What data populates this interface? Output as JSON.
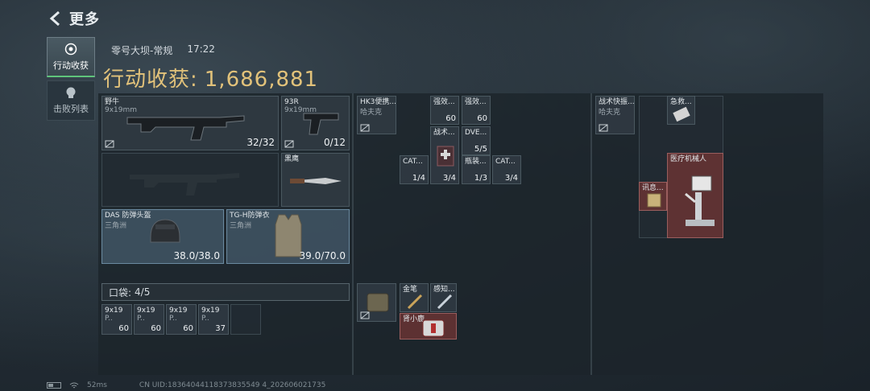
{
  "header": {
    "title": "更多"
  },
  "tabs": [
    {
      "label": "行动收获"
    },
    {
      "label": "击败列表"
    }
  ],
  "map_info": {
    "map": "零号大坝-常规",
    "time": "17:22"
  },
  "haul": {
    "label": "行动收获:",
    "value": "1,686,881"
  },
  "equipment": {
    "primary": {
      "name": "野牛",
      "caliber": "9x19mm",
      "ammo": "32/32"
    },
    "sidearm": {
      "name": "93R",
      "caliber": "9x19mm",
      "ammo": "0/12"
    },
    "melee": {
      "name": "黑鹰"
    },
    "helmet": {
      "name": "DAS 防弹头盔",
      "origin": "三角洲",
      "durability": "38.0/38.0"
    },
    "armor": {
      "name": "TG-H防弹衣",
      "origin": "三角洲",
      "durability": "39.0/70.0"
    }
  },
  "pouch": {
    "label": "口袋:",
    "count": "4/5",
    "items": [
      {
        "name": "9x19",
        "sub": "P..",
        "qty": "60"
      },
      {
        "name": "9x19",
        "sub": "P..",
        "qty": "60"
      },
      {
        "name": "9x19",
        "sub": "P..",
        "qty": "60"
      },
      {
        "name": "9x19",
        "sub": "P..",
        "qty": "37"
      }
    ]
  },
  "chest_rig": {
    "name": "HK3便携...",
    "sub": "哈夫克",
    "items": [
      {
        "name": "强效...",
        "qty": "60"
      },
      {
        "name": "强效...",
        "qty": "60"
      },
      {
        "name": "战术...",
        "qty": "3/4"
      },
      {
        "name": "DVE...",
        "qty": "5/5"
      },
      {
        "name": "CAT...",
        "qty": "1/4"
      },
      {
        "name": "瓶装...",
        "qty": "1/3"
      },
      {
        "name": "CAT...",
        "qty": "3/4"
      }
    ]
  },
  "backpack_small": {
    "items": [
      {
        "name": "金笔"
      },
      {
        "name": "感知..."
      },
      {
        "name": "肾小鹿..."
      }
    ]
  },
  "backpack": {
    "name": "战术快振...",
    "sub": "哈夫克",
    "items": [
      {
        "name": "急救..."
      },
      {
        "name": "医疗机械人"
      },
      {
        "name": "讯息..."
      }
    ]
  },
  "footer": {
    "ping": "52ms",
    "uid": "CN UID:18364044118373835549 4_202606021735"
  },
  "colors": {
    "accent_gold": "#e2c27a",
    "active_tab": "#5fc47b",
    "medic_red": "#683434"
  }
}
